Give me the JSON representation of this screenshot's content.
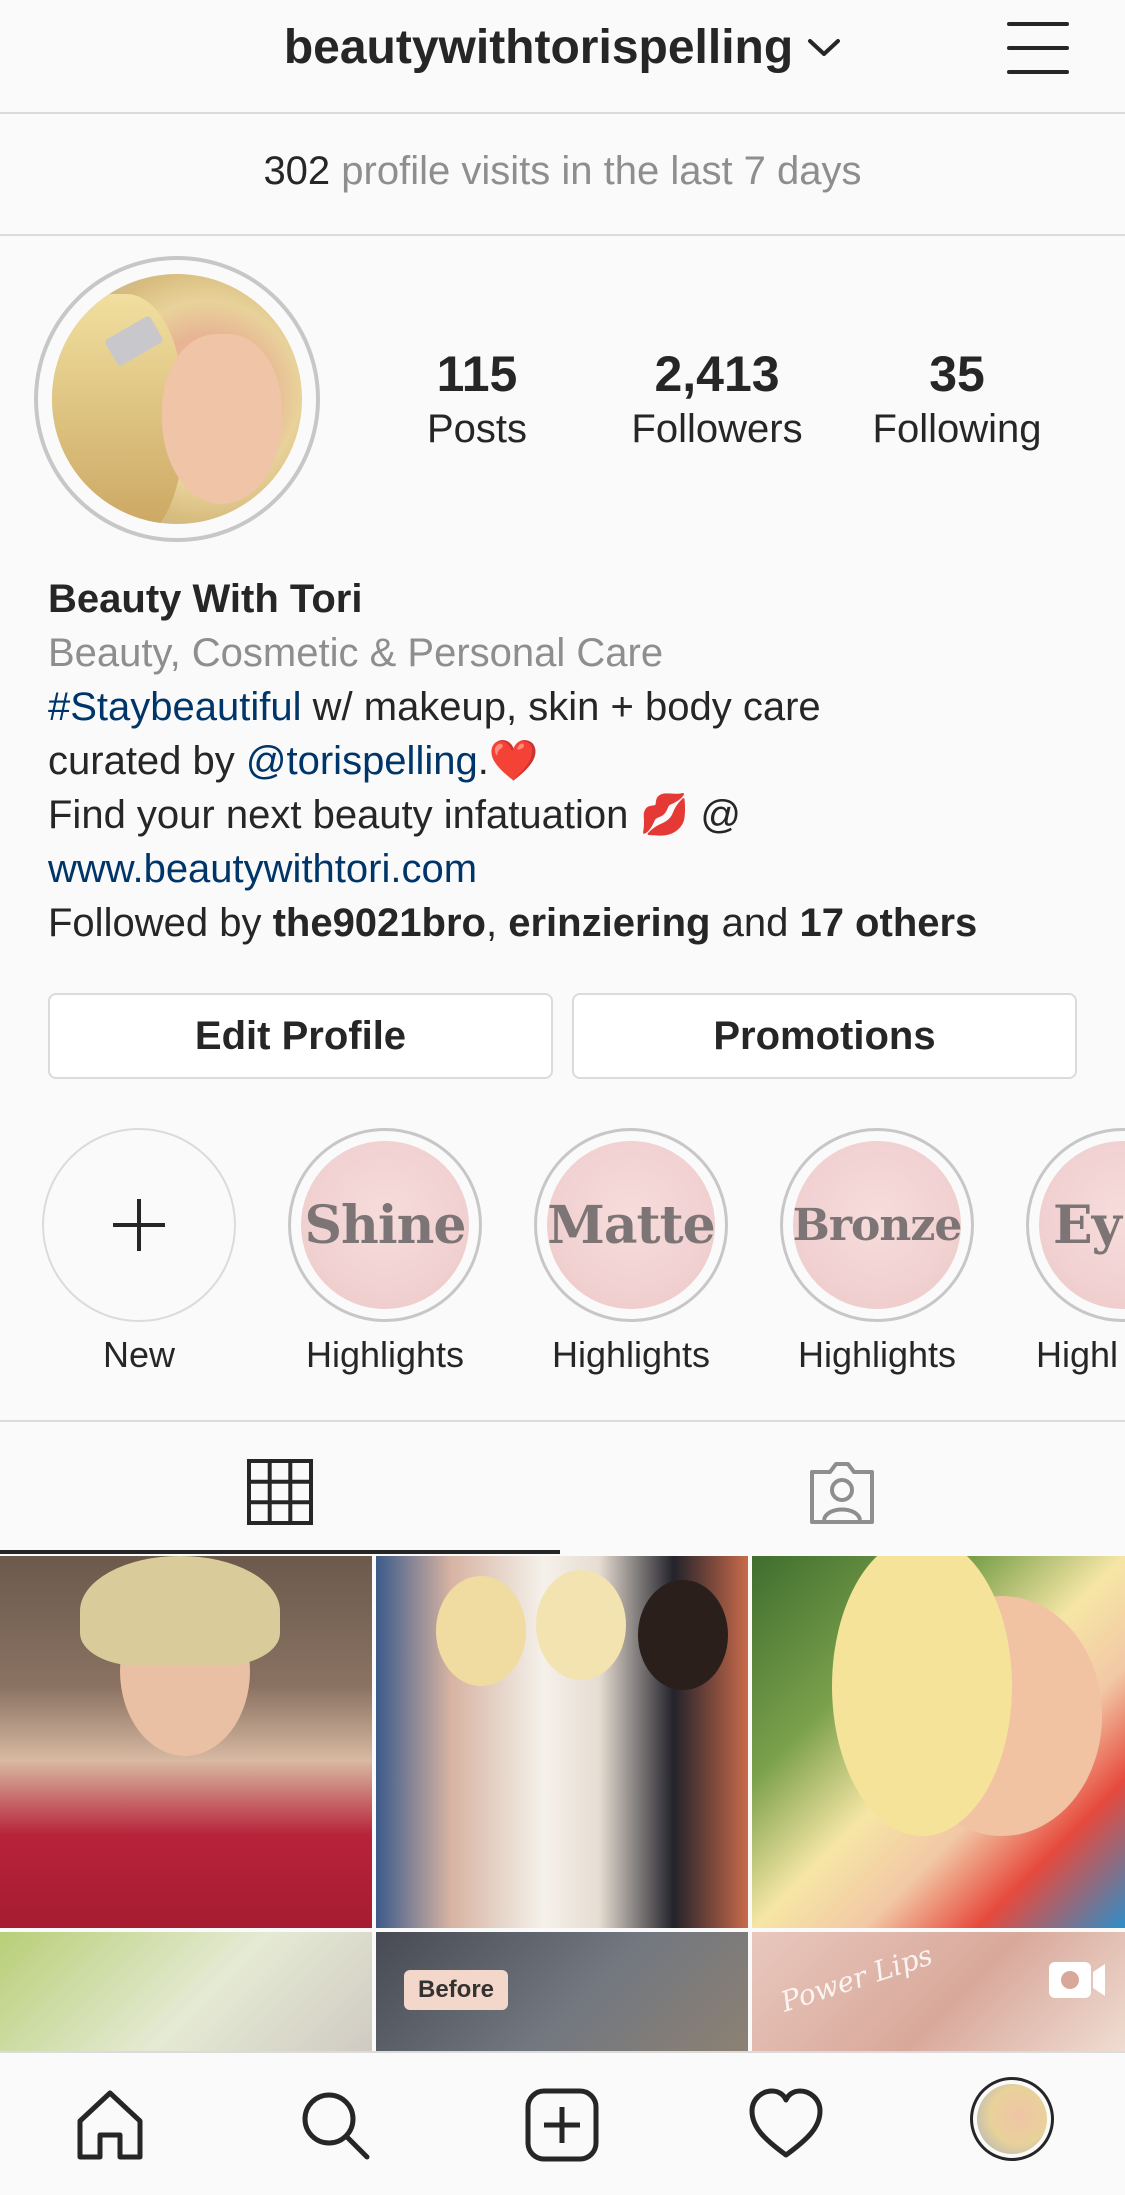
{
  "header": {
    "username": "beautywithtorispelling",
    "chevron_icon": "chevron-down-icon",
    "menu_icon": "hamburger-menu-icon"
  },
  "insights": {
    "visits_count": "302",
    "visits_text": " profile visits in the last 7 days"
  },
  "profile": {
    "stats": [
      {
        "value": "115",
        "label": "Posts"
      },
      {
        "value": "2,413",
        "label": "Followers"
      },
      {
        "value": "35",
        "label": "Following"
      }
    ],
    "name": "Beauty With Tori",
    "category": "Beauty, Cosmetic & Personal Care",
    "bio": {
      "hashtag": "#Staybeautiful",
      "line1_rest": " w/ makeup, skin + body care",
      "line2_prefix": "curated by ",
      "mention": "@torispelling",
      "line2_suffix": ".❤️",
      "line3": "Find your next beauty infatuation 💋 @",
      "website": "www.beautywithtori.com"
    },
    "followed_by": {
      "prefix": "Followed by ",
      "user1": "the9021bro",
      "sep": ", ",
      "user2": "erinziering",
      "and": " and ",
      "others": "17 others"
    }
  },
  "actions": {
    "edit_profile": "Edit Profile",
    "promotions": "Promotions"
  },
  "highlights": [
    {
      "cover_text": "",
      "label": "New"
    },
    {
      "cover_text": "Shine",
      "label": "Highlights"
    },
    {
      "cover_text": "Matte",
      "label": "Highlights"
    },
    {
      "cover_text": "Bronze",
      "label": "Highlights"
    },
    {
      "cover_text": "Ey",
      "label": "Highl"
    }
  ],
  "tabs": {
    "grid_icon": "grid-icon",
    "tagged_icon": "tagged-person-icon",
    "active": "grid"
  },
  "posts": {
    "before_tag": "Before",
    "powerlips_text": "Power Lips",
    "igtv_icon": "igtv-icon"
  },
  "bottom_nav": [
    "home-icon",
    "search-icon",
    "add-post-icon",
    "activity-heart-icon",
    "profile-avatar"
  ],
  "colors": {
    "link": "#003569",
    "secondary_text": "#8e8e8e",
    "border": "#dbdbdb",
    "primary_text": "#262626"
  }
}
